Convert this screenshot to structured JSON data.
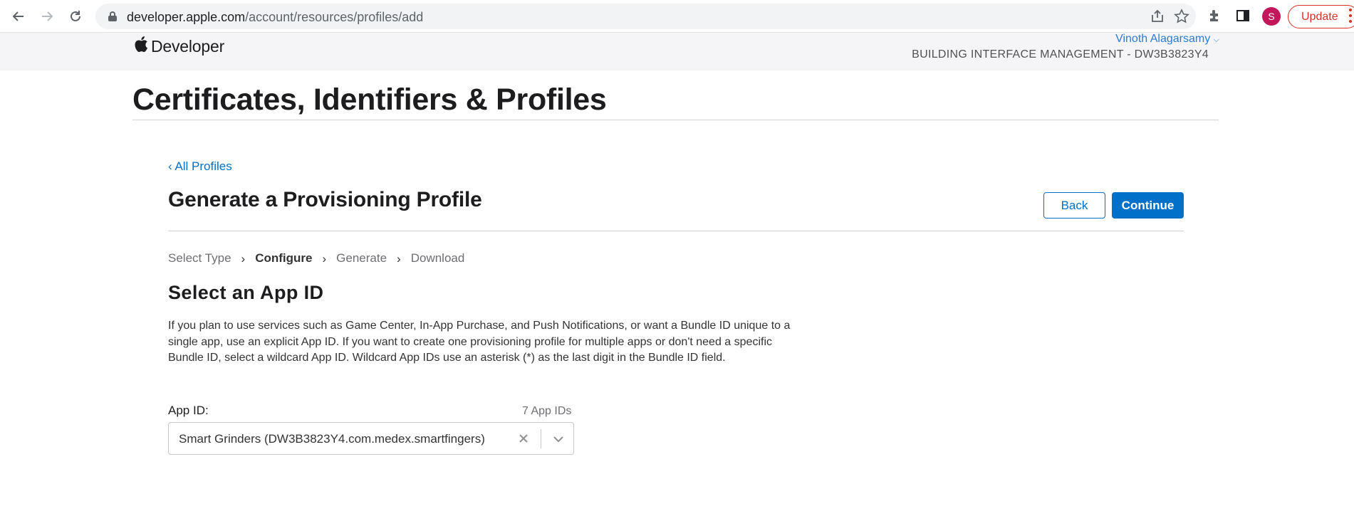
{
  "browser": {
    "url_host": "developer.apple.com",
    "url_path": "/account/resources/profiles/add",
    "avatar_letter": "S",
    "update_label": "Update",
    "icons": [
      "back-arrow-icon",
      "forward-arrow-icon",
      "reload-icon",
      "lock-icon",
      "share-icon",
      "star-icon",
      "extensions-icon",
      "side-panel-icon",
      "kebab-menu-icon"
    ]
  },
  "header": {
    "brand": "Developer",
    "account_name": "Vinoth Alagarsamy",
    "team": "BUILDING INTERFACE MANAGEMENT - DW3B3823Y4"
  },
  "page": {
    "title": "Certificates, Identifiers & Profiles"
  },
  "content": {
    "back_link": "‹ All Profiles",
    "section_title": "Generate a Provisioning Profile",
    "back_button": "Back",
    "continue_button": "Continue",
    "steps": [
      {
        "label": "Select Type",
        "active": false
      },
      {
        "label": "Configure",
        "active": true
      },
      {
        "label": "Generate",
        "active": false
      },
      {
        "label": "Download",
        "active": false
      }
    ],
    "heading": "Select an App ID",
    "description": "If you plan to use services such as Game Center, In-App Purchase, and Push Notifications, or want a Bundle ID unique to a single app, use an explicit App ID. If you want to create one provisioning profile for multiple apps or don't need a specific Bundle ID, select a wildcard App ID. Wildcard App IDs use an asterisk (*) as the last digit in the Bundle ID field.",
    "app_id_label": "App ID:",
    "app_id_count": "7 App IDs",
    "app_id_value": "Smart Grinders (DW3B3823Y4.com.medex.smartfingers)"
  },
  "colors": {
    "accent": "#0070c9",
    "header_bg": "#f5f5f7",
    "update_red": "#d93025",
    "avatar": "#c2185b"
  }
}
